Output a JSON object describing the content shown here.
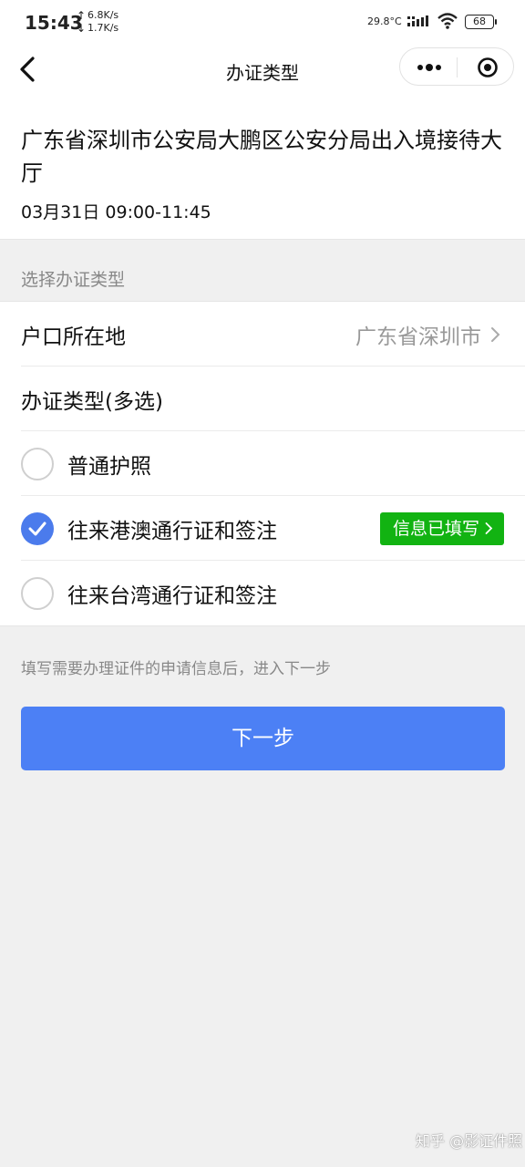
{
  "status_bar": {
    "time": "15:43",
    "upload_speed": "6.8K/s",
    "download_speed": "1.7K/s",
    "temperature": "29.8°C",
    "battery": "68"
  },
  "nav": {
    "title": "办证类型",
    "back_icon": "chevron-left-icon",
    "more_icon": "more-dots-icon",
    "close_icon": "target-icon"
  },
  "header": {
    "office_name": "广东省深圳市公安局大鹏区公安分局出入境接待大厅",
    "appointment_time": "03月31日 09:00-11:45"
  },
  "section_label": "选择办证类型",
  "form": {
    "residence": {
      "label": "户口所在地",
      "value": "广东省深圳市"
    },
    "types_header": "办证类型(多选)",
    "options": [
      {
        "label": "普通护照",
        "checked": false
      },
      {
        "label": "往来港澳通行证和签注",
        "checked": true,
        "badge": "信息已填写"
      },
      {
        "label": "往来台湾通行证和签注",
        "checked": false
      }
    ]
  },
  "hint": "填写需要办理证件的申请信息后，进入下一步",
  "next_button": "下一步",
  "watermark": "知乎 @影证件照",
  "colors": {
    "primary": "#4c80f5",
    "check": "#4b7bec",
    "badge": "#12b312",
    "background": "#f0f0f0"
  }
}
